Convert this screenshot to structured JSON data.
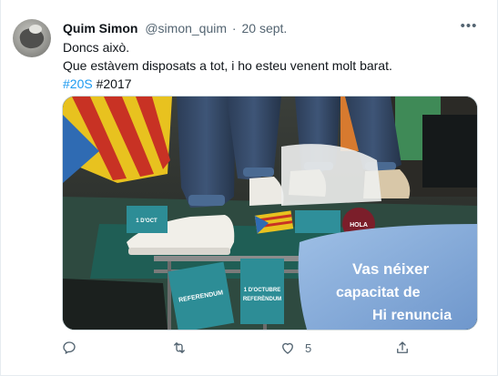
{
  "tweet": {
    "author_name": "Quim Simon",
    "author_handle": "@simon_quim",
    "separator": "·",
    "date": "20 sept.",
    "more_icon": "more-horizontal-icon",
    "lines": {
      "line1": "Doncs això.",
      "line2": "Que estàvem disposats a tot, i ho esteu venent molt barat.",
      "hashtag1": "#20S",
      "hashtag2": "#2017"
    },
    "hashtag_color": "#1d9bf0"
  },
  "media": {
    "flyer_line1": "1 D'OCTUBRE",
    "flyer_line2": "REFERÈNDUM",
    "flyer_line3": "REFERENDUM",
    "flyer_line4": "1 D'OCT",
    "shirt_line1": "Vas néixer",
    "shirt_line2": "capacitat de",
    "shirt_line3": "Hi renuncia",
    "badge_text": "HOLA"
  },
  "actions": {
    "reply_icon": "reply-icon",
    "retweet_icon": "retweet-icon",
    "like_icon": "heart-icon",
    "like_count": "5",
    "share_icon": "share-icon"
  }
}
